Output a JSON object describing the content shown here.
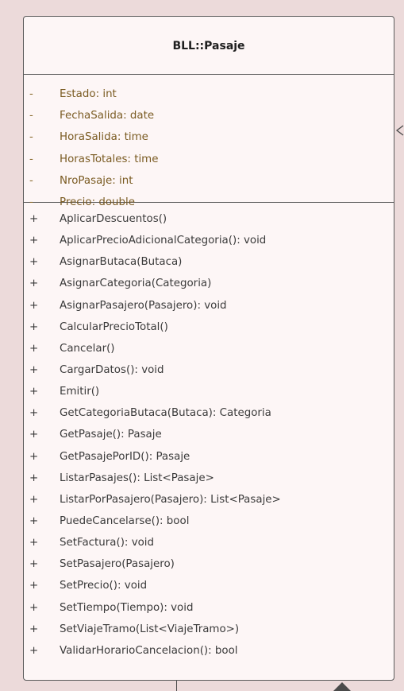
{
  "class": {
    "name": "BLL::Pasaje",
    "attributes": [
      {
        "visibility": "-",
        "text": "Estado: int"
      },
      {
        "visibility": "-",
        "text": "FechaSalida: date"
      },
      {
        "visibility": "-",
        "text": "HoraSalida: time"
      },
      {
        "visibility": "-",
        "text": "HorasTotales: time"
      },
      {
        "visibility": "-",
        "text": "NroPasaje: int"
      },
      {
        "visibility": "-",
        "text": "Precio: double"
      }
    ],
    "operations": [
      {
        "visibility": "+",
        "text": "AplicarDescuentos()"
      },
      {
        "visibility": "+",
        "text": "AplicarPrecioAdicionalCategoria(): void"
      },
      {
        "visibility": "+",
        "text": "AsignarButaca(Butaca)"
      },
      {
        "visibility": "+",
        "text": "AsignarCategoria(Categoria)"
      },
      {
        "visibility": "+",
        "text": "AsignarPasajero(Pasajero): void"
      },
      {
        "visibility": "+",
        "text": "CalcularPrecioTotal()"
      },
      {
        "visibility": "+",
        "text": "Cancelar()"
      },
      {
        "visibility": "+",
        "text": "CargarDatos(): void"
      },
      {
        "visibility": "+",
        "text": "Emitir()"
      },
      {
        "visibility": "+",
        "text": "GetCategoriaButaca(Butaca): Categoria"
      },
      {
        "visibility": "+",
        "text": "GetPasaje(): Pasaje"
      },
      {
        "visibility": "+",
        "text": "GetPasajePorID(): Pasaje"
      },
      {
        "visibility": "+",
        "text": "ListarPasajes(): List<Pasaje>"
      },
      {
        "visibility": "+",
        "text": "ListarPorPasajero(Pasajero): List<Pasaje>"
      },
      {
        "visibility": "+",
        "text": "PuedeCancelarse(): bool"
      },
      {
        "visibility": "+",
        "text": "SetFactura(): void"
      },
      {
        "visibility": "+",
        "text": "SetPasajero(Pasajero)"
      },
      {
        "visibility": "+",
        "text": "SetPrecio(): void"
      },
      {
        "visibility": "+",
        "text": "SetTiempo(Tiempo): void"
      },
      {
        "visibility": "+",
        "text": "SetViajeTramo(List<ViajeTramo>)"
      },
      {
        "visibility": "+",
        "text": "ValidarHorarioCancelacion(): bool"
      }
    ]
  },
  "colors": {
    "canvas_background": "#ecdada",
    "class_fill": "#fdf6f6",
    "border": "#5a5a5a",
    "attribute_text": "#7a5b22",
    "operation_text": "#3a3a3a"
  }
}
